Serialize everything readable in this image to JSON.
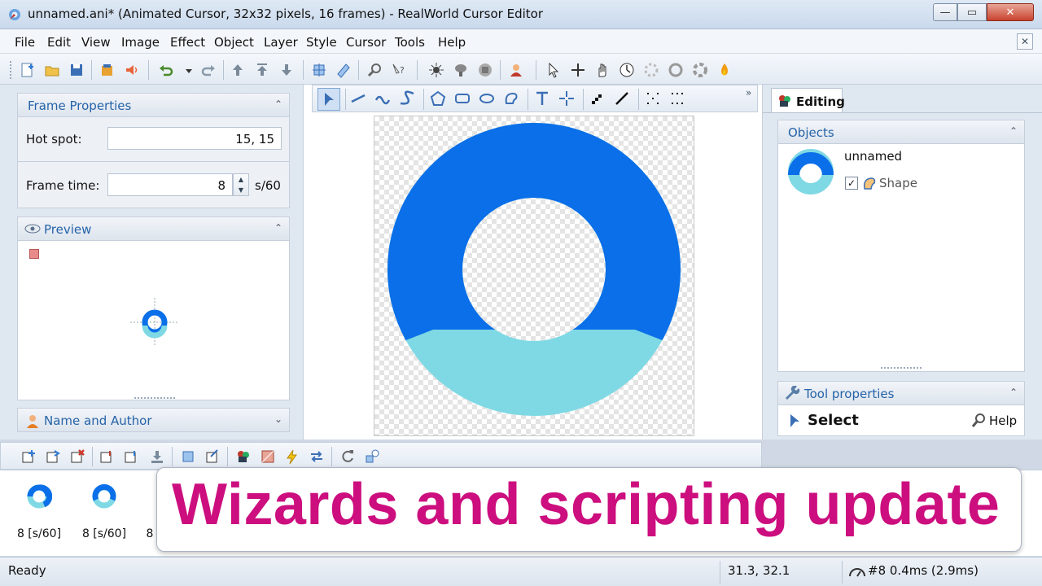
{
  "window": {
    "title": "unnamed.ani* (Animated Cursor, 32x32 pixels, 16 frames) - RealWorld Cursor Editor",
    "min_glyph": "—",
    "max_glyph": "▭",
    "close_glyph": "✕"
  },
  "menu": {
    "items": [
      "File",
      "Edit",
      "View",
      "Image",
      "Effect",
      "Object",
      "Layer",
      "Style",
      "Cursor",
      "Tools",
      "Help"
    ],
    "close_glyph": "✕"
  },
  "frame_properties": {
    "title": "Frame Properties",
    "hotspot_label": "Hot spot:",
    "hotspot_value": "15, 15",
    "frametime_label": "Frame time:",
    "frametime_value": "8",
    "frametime_unit": "s/60"
  },
  "preview": {
    "title": "Preview"
  },
  "name_author": {
    "title": "Name and Author"
  },
  "editing": {
    "tab_label": "Editing",
    "objects_title": "Objects",
    "object_name": "unnamed",
    "shape_label": "Shape",
    "tool_properties_title": "Tool properties",
    "tool_name": "Select",
    "help_label": "Help"
  },
  "frames": [
    {
      "label": "8 [s/60]"
    },
    {
      "label": "8 [s/60]"
    },
    {
      "label": "8"
    }
  ],
  "status": {
    "ready": "Ready",
    "coords": "31.3, 32.1",
    "timing": "#8 0.4ms (2.9ms)"
  },
  "banner": {
    "text": "Wizards and scripting update"
  },
  "colors": {
    "ring_dark": "#0a6fe8",
    "ring_light": "#7fd9e4",
    "accent_title": "#2563a8",
    "banner_text": "#cc0e7e"
  }
}
